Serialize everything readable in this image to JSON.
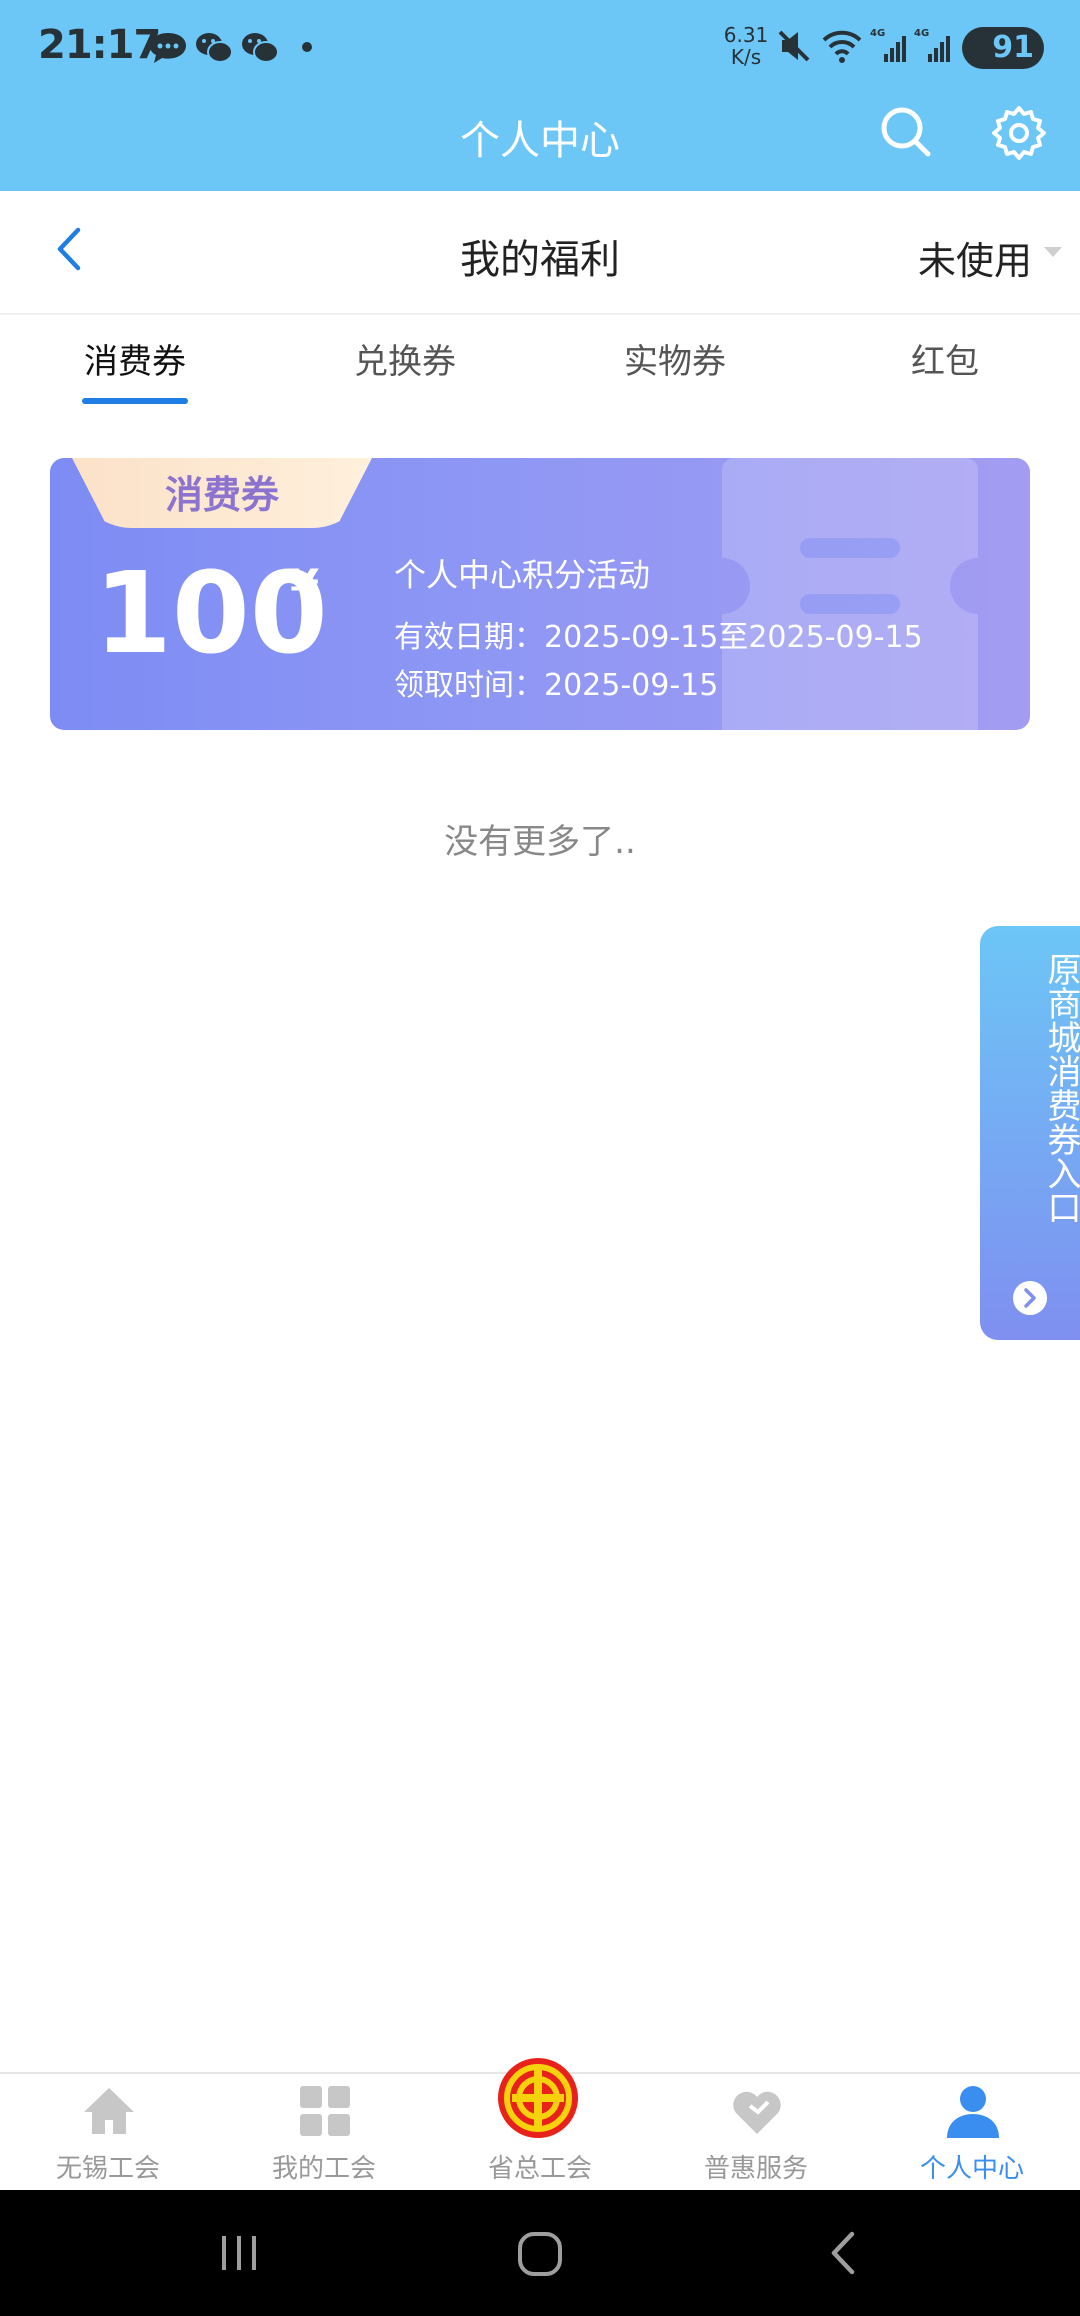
{
  "status_bar": {
    "time": "21:17",
    "speed_value": "6.31",
    "speed_unit": "K/s",
    "battery": "91",
    "icons": [
      "message-icon",
      "wechat-icon",
      "wechat-icon",
      "mute-icon",
      "wifi-icon",
      "signal-4g-icon",
      "signal-4g-icon",
      "battery-icon"
    ]
  },
  "app_header": {
    "title": "个人中心",
    "search_icon": "search-icon",
    "settings_icon": "gear-icon"
  },
  "sub_header": {
    "title": "我的福利",
    "filter_value": "未使用",
    "back_icon": "chevron-left-icon"
  },
  "tabs": [
    {
      "label": "消费券",
      "active": true
    },
    {
      "label": "兑换券",
      "active": false
    },
    {
      "label": "实物券",
      "active": false
    },
    {
      "label": "红包",
      "active": false
    }
  ],
  "coupon": {
    "tag": "消费券",
    "amount": "100",
    "currency": "¥",
    "name": "个人中心积分活动",
    "valid": "有效日期：2025-09-15至2025-09-15",
    "received": "领取时间：2025-09-15"
  },
  "list_end_text": "没有更多了..",
  "side_entry": {
    "label": "原商城消费券入口",
    "arrow_icon": "chevron-right-circle-icon"
  },
  "bottom_nav": [
    {
      "label": "无锡工会",
      "icon": "home-icon",
      "active": false
    },
    {
      "label": "我的工会",
      "icon": "grid-icon",
      "active": false
    },
    {
      "label": "省总工会",
      "icon": "union-emblem-icon",
      "active": false
    },
    {
      "label": "普惠服务",
      "icon": "heart-icon",
      "active": false
    },
    {
      "label": "个人中心",
      "icon": "person-icon",
      "active": true
    }
  ],
  "colors": {
    "header": "#6cc6f6",
    "accent": "#1f7de6",
    "nav_active": "#3a8ef0",
    "coupon_start": "#7d8cf4",
    "coupon_end": "#a39cf2"
  }
}
